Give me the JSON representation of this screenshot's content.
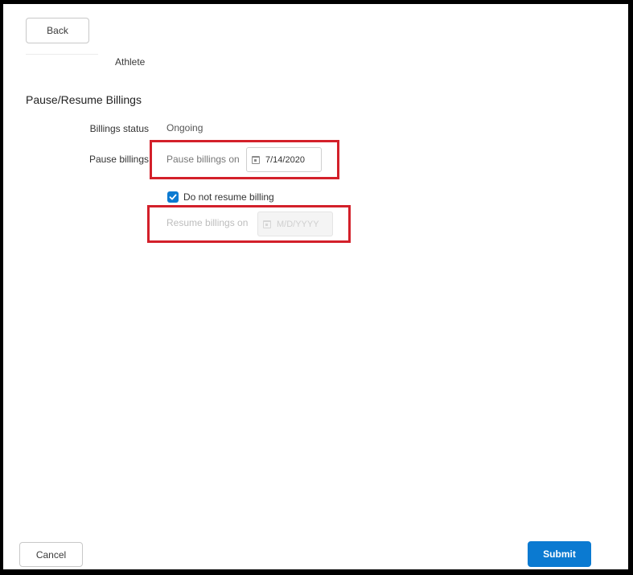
{
  "header": {
    "back_label": "Back",
    "subtitle": "Athlete"
  },
  "section": {
    "title": "Pause/Resume Billings",
    "status_label": "Billings status",
    "status_value": "Ongoing",
    "pause_label": "Pause billings",
    "pause_on_label": "Pause billings on",
    "pause_date_value": "7/14/2020",
    "do_not_resume_label": "Do not resume billing",
    "do_not_resume_checked": true,
    "resume_on_label": "Resume billings on",
    "resume_date_placeholder": "M/D/YYYY"
  },
  "footer": {
    "cancel_label": "Cancel",
    "submit_label": "Submit"
  },
  "colors": {
    "accent": "#0b7ad1",
    "highlight": "#d3202a"
  }
}
